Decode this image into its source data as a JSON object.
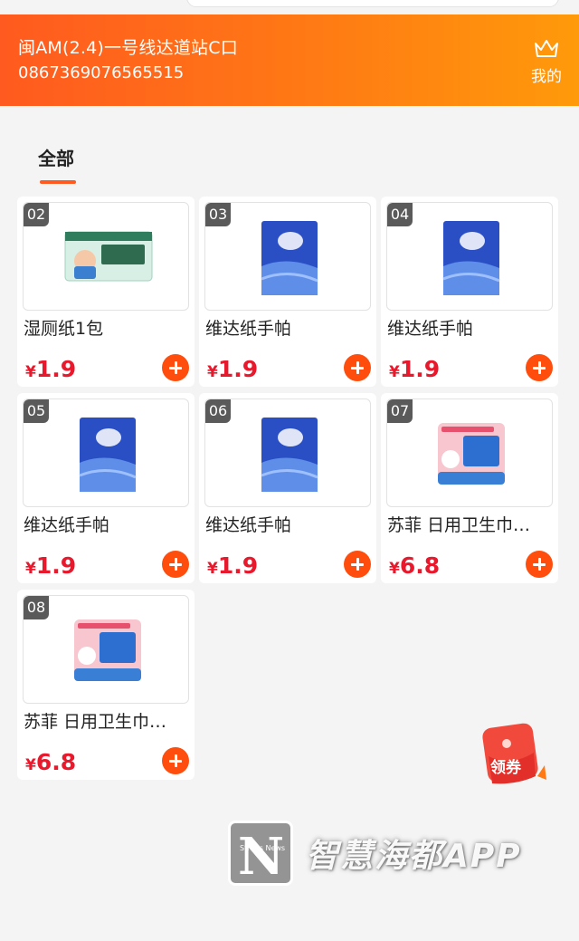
{
  "header": {
    "store_name": "闽AM(2.4)一号线达道站C口",
    "phone": "0867369076565515",
    "mine_label": "我的",
    "mine_icon": "crown-icon"
  },
  "tabs": [
    {
      "label": "全部",
      "active": true
    }
  ],
  "currency": "¥",
  "accent_color": "#ff5a1f",
  "price_color": "#e8192c",
  "products": [
    {
      "num": "02",
      "name": "湿厕纸1包",
      "price": "1.9",
      "image": "wet-wipes-pack"
    },
    {
      "num": "03",
      "name": "维达纸手帕",
      "price": "1.9",
      "image": "vinda-tissue-pack"
    },
    {
      "num": "04",
      "name": "维达纸手帕",
      "price": "1.9",
      "image": "vinda-tissue-pack"
    },
    {
      "num": "05",
      "name": "维达纸手帕",
      "price": "1.9",
      "image": "vinda-tissue-pack"
    },
    {
      "num": "06",
      "name": "维达纸手帕",
      "price": "1.9",
      "image": "vinda-tissue-pack"
    },
    {
      "num": "07",
      "name": "苏菲 日用卫生巾…",
      "price": "6.8",
      "image": "sofy-pad-pack"
    },
    {
      "num": "08",
      "name": "苏菲 日用卫生巾…",
      "price": "6.8",
      "image": "sofy-pad-pack"
    }
  ],
  "coupon": {
    "label": "领券"
  },
  "watermark": {
    "text": "智慧海都APP",
    "logo_letter": "N",
    "logo_small": "Straits News"
  }
}
